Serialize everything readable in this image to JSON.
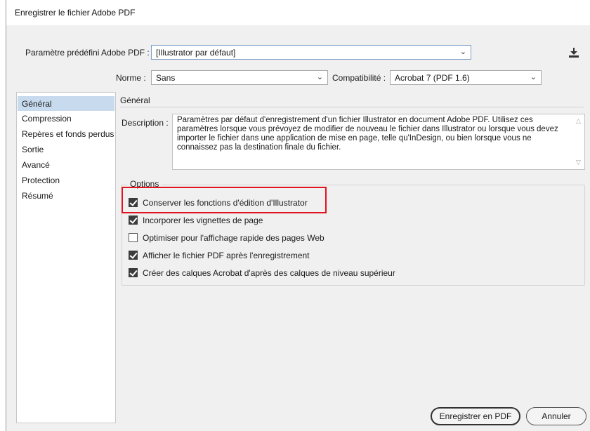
{
  "window": {
    "title": "Enregistrer le fichier Adobe PDF"
  },
  "preset": {
    "label": "Paramètre prédéfini Adobe PDF :",
    "value": "[Illustrator par défaut]"
  },
  "norme": {
    "label": "Norme :",
    "value": "Sans"
  },
  "compat": {
    "label": "Compatibilité :",
    "value": "Acrobat 7 (PDF 1.6)"
  },
  "sidebar": {
    "items": [
      {
        "label": "Général",
        "selected": true
      },
      {
        "label": "Compression"
      },
      {
        "label": "Repères et fonds perdus"
      },
      {
        "label": "Sortie"
      },
      {
        "label": "Avancé"
      },
      {
        "label": "Protection"
      },
      {
        "label": "Résumé"
      }
    ]
  },
  "main": {
    "section_title": "Général",
    "description": {
      "label": "Description :",
      "text": "Paramètres par défaut d'enregistrement d'un fichier Illustrator en document Adobe PDF. Utilisez ces paramètres lorsque vous prévoyez de modifier de nouveau le fichier dans Illustrator ou lorsque vous devez importer le fichier dans une application de mise en page, telle qu'InDesign, ou bien lorsque vous ne connaissez pas la destination finale du fichier."
    },
    "options": {
      "legend": "Options",
      "items": [
        {
          "label": "Conserver les fonctions d'édition d'Illustrator",
          "checked": true
        },
        {
          "label": "Incorporer les vignettes de page",
          "checked": true
        },
        {
          "label": "Optimiser pour l'affichage rapide des pages Web",
          "checked": false
        },
        {
          "label": "Afficher le fichier PDF après l'enregistrement",
          "checked": true
        },
        {
          "label": "Créer des calques Acrobat d'après des calques de niveau supérieur",
          "checked": true
        }
      ]
    }
  },
  "buttons": {
    "save": "Enregistrer en PDF",
    "cancel": "Annuler"
  },
  "icons": {
    "chevron": "chevron-down-icon",
    "save_preset": "save-preset-icon",
    "scroll_up": "scroll-up-icon",
    "scroll_down": "scroll-down-icon"
  },
  "colors": {
    "highlight": "#e0141e",
    "selected_item": "#c7daee",
    "dialog_bg": "#f0f0f0"
  }
}
